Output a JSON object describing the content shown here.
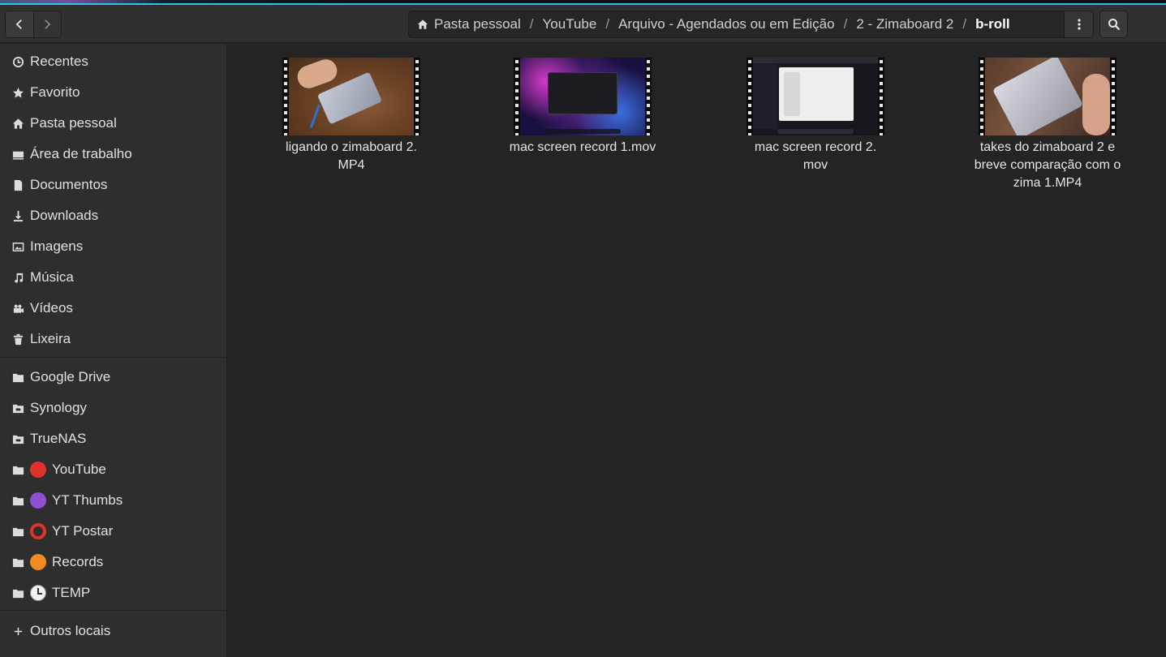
{
  "header": {
    "back_icon": "go-previous-icon",
    "forward_icon": "go-next-icon",
    "breadcrumbs": [
      {
        "label": "Pasta pessoal",
        "icon": "home-icon"
      },
      {
        "label": "YouTube"
      },
      {
        "label": "Arquivo - Agendados ou em Edição"
      },
      {
        "label": "2 - Zimaboard 2"
      },
      {
        "label": "b-roll",
        "current": true
      }
    ],
    "separator": "/",
    "menu_icon": "view-more-icon",
    "search_icon": "search-icon"
  },
  "sidebar": {
    "places": [
      {
        "label": "Recentes",
        "icon": "clock-icon"
      },
      {
        "label": "Favorito",
        "icon": "star-icon"
      },
      {
        "label": "Pasta pessoal",
        "icon": "home-icon"
      },
      {
        "label": "Área de trabalho",
        "icon": "desktop-icon"
      },
      {
        "label": "Documentos",
        "icon": "document-icon"
      },
      {
        "label": "Downloads",
        "icon": "download-icon"
      },
      {
        "label": "Imagens",
        "icon": "image-icon"
      },
      {
        "label": "Música",
        "icon": "music-icon"
      },
      {
        "label": "Vídeos",
        "icon": "video-icon"
      },
      {
        "label": "Lixeira",
        "icon": "trash-icon"
      }
    ],
    "bookmarks": [
      {
        "label": "Google Drive",
        "icon": "folder-icon",
        "emoji": ""
      },
      {
        "label": "Synology",
        "icon": "network-folder-icon",
        "emoji": ""
      },
      {
        "label": "TrueNAS",
        "icon": "network-folder-icon",
        "emoji": ""
      },
      {
        "label": "YouTube",
        "icon": "folder-icon",
        "emoji": "red-circle"
      },
      {
        "label": "YT Thumbs",
        "icon": "folder-icon",
        "emoji": "purple-circle"
      },
      {
        "label": "YT Postar",
        "icon": "folder-icon",
        "emoji": "hollow-red-circle"
      },
      {
        "label": "Records",
        "icon": "folder-icon",
        "emoji": "orange-circle"
      },
      {
        "label": "TEMP",
        "icon": "folder-icon",
        "emoji": "clock"
      }
    ],
    "other_locations": {
      "label": "Outros locais",
      "icon": "plus-icon"
    }
  },
  "files": [
    {
      "name": "ligando o zimaboard 2.\nMP4",
      "thumbnail": "video-thumbnail"
    },
    {
      "name": "mac screen record 1.mov",
      "thumbnail": "video-thumbnail"
    },
    {
      "name": "mac screen record 2.\nmov",
      "thumbnail": "video-thumbnail"
    },
    {
      "name": "takes do zimaboard 2 e breve comparação com o zima 1.MP4",
      "thumbnail": "video-thumbnail"
    }
  ],
  "colors": {
    "accent": "#2fc6e6",
    "window_bg": "#242424",
    "sidebar_bg": "#2e2e2e",
    "headerbar_bg": "#303030"
  }
}
